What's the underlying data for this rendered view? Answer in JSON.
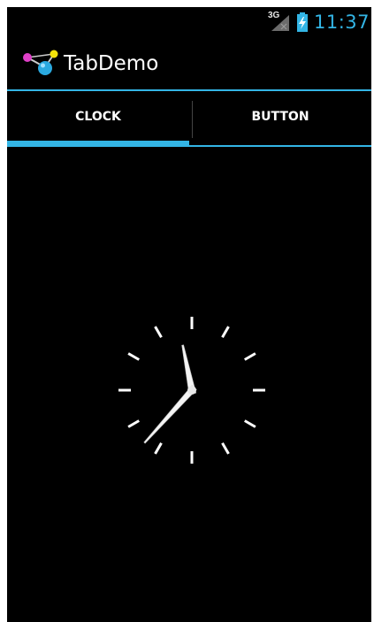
{
  "status_bar": {
    "network_type": "3G",
    "time": "11:37",
    "signal_icon": "signal-strength-icon",
    "battery_icon": "battery-charging-icon"
  },
  "action_bar": {
    "app_icon": "molecule-app-icon",
    "title": "TabDemo"
  },
  "tabs": [
    {
      "label": "CLOCK",
      "selected": true
    },
    {
      "label": "BUTTON",
      "selected": false
    }
  ],
  "analog_clock": {
    "hour": 11,
    "minute": 37
  },
  "colors": {
    "accent": "#33b5e5",
    "background": "#000000",
    "text": "#ffffff"
  }
}
